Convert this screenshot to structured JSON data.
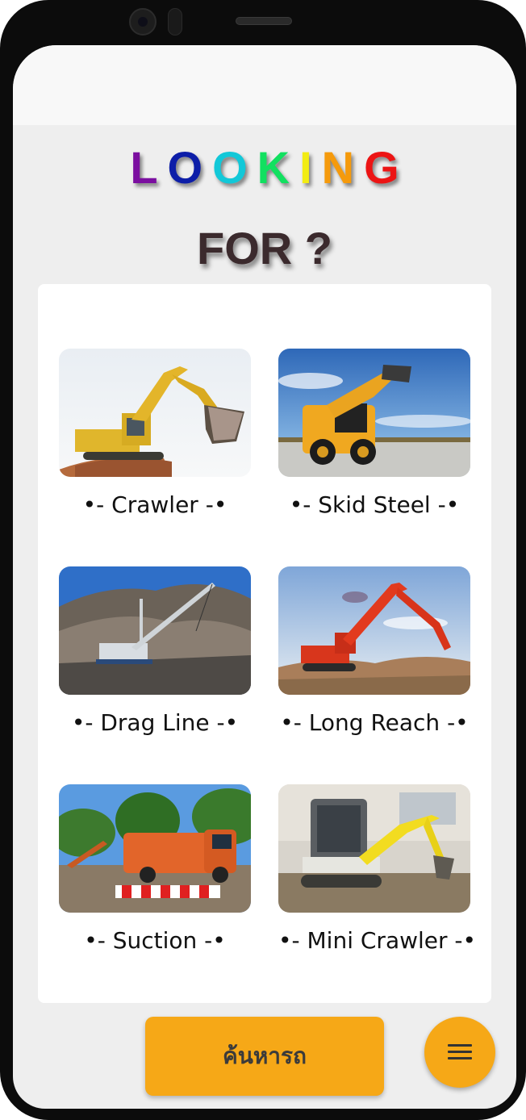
{
  "header": {
    "looking_letters": [
      {
        "char": "L",
        "color": "#7b0fa0"
      },
      {
        "char": "O",
        "color": "#0d1ea8"
      },
      {
        "char": "O",
        "color": "#12c8d8"
      },
      {
        "char": "K",
        "color": "#12e060"
      },
      {
        "char": "I",
        "color": "#f2ec14"
      },
      {
        "char": "N",
        "color": "#f59a0c"
      },
      {
        "char": "G",
        "color": "#ec1414"
      }
    ],
    "subtitle": "FOR ?"
  },
  "categories": [
    {
      "label": "•- Crawler -•",
      "image": "crawler-excavator-image"
    },
    {
      "label": "•- Skid Steel -•",
      "image": "skid-steer-loader-image"
    },
    {
      "label": "•- Drag Line -•",
      "image": "dragline-excavator-image"
    },
    {
      "label": "•- Long Reach -•",
      "image": "long-reach-excavator-image"
    },
    {
      "label": "•- Suction -•",
      "image": "suction-excavator-truck-image"
    },
    {
      "label": "•- Mini Crawler -•",
      "image": "mini-crawler-excavator-image"
    }
  ],
  "actions": {
    "search_label": "ค้นหารถ",
    "menu_icon": "hamburger-menu-icon"
  },
  "colors": {
    "accent": "#f6a817",
    "background": "#eeeeee",
    "card": "#ffffff"
  }
}
